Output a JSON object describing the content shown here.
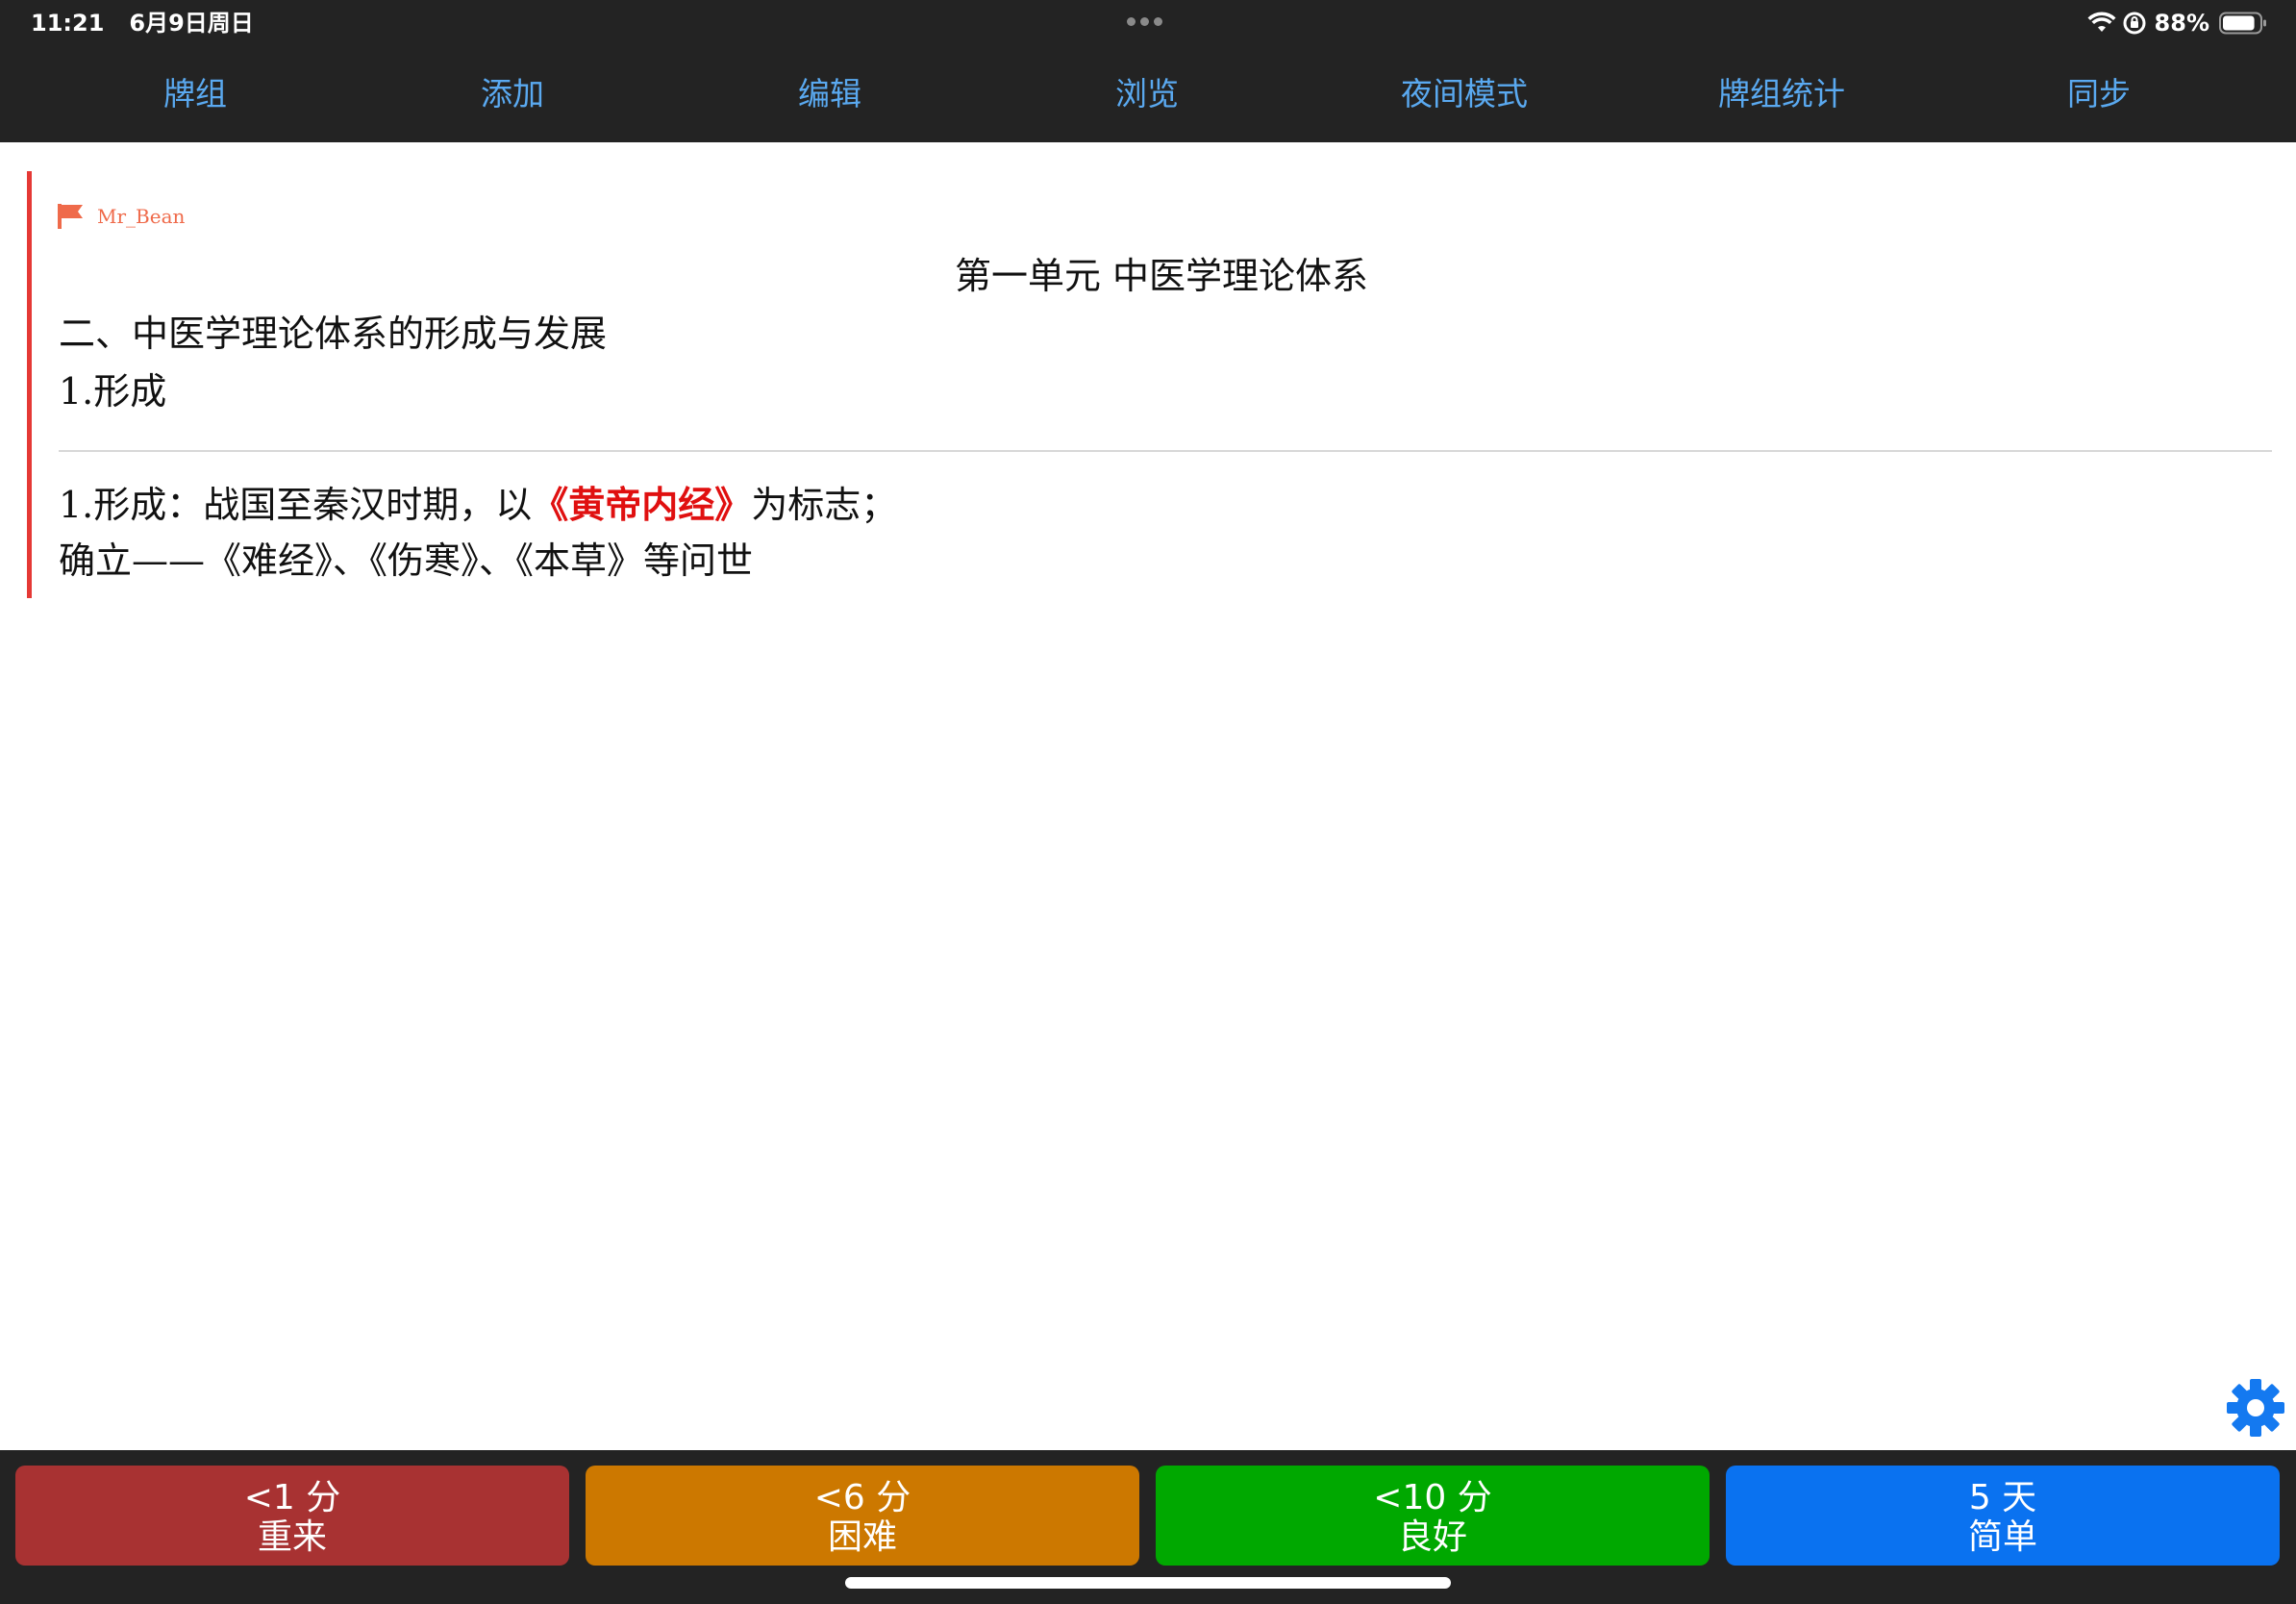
{
  "status_bar": {
    "time": "11:21",
    "date": "6月9日周日",
    "battery_text": "88%",
    "battery_level": 0.88,
    "icons": [
      "wifi-icon",
      "orientation-lock-icon",
      "battery-icon"
    ]
  },
  "nav": {
    "items": [
      {
        "label": "牌组"
      },
      {
        "label": "添加"
      },
      {
        "label": "编辑"
      },
      {
        "label": "浏览"
      },
      {
        "label": "夜间模式"
      },
      {
        "label": "牌组统计"
      },
      {
        "label": "同步"
      }
    ],
    "color": "#5aa9f0"
  },
  "card": {
    "flag_icon": "flag-icon",
    "flag_color": "#ef6a4a",
    "tag": "Mr_Bean",
    "unit_title": "第一单元 中医学理论体系",
    "front": [
      "二、中医学理论体系的形成与发展",
      "1.形成"
    ],
    "back": {
      "line1_prefix": "1.形成：战国至秦汉时期，以",
      "line1_highlight": "《黄帝内经》",
      "line1_suffix": "为标志；",
      "line2": "确立——《难经》、《伤寒》、《本草》等问世",
      "highlight_color": "#e01010"
    },
    "border_color": "#e53935"
  },
  "settings": {
    "icon": "gear-icon",
    "color": "#1479f0"
  },
  "answers": [
    {
      "interval": "<1 分",
      "label": "重来",
      "color": "#a83232"
    },
    {
      "interval": "<6 分",
      "label": "困难",
      "color": "#cc7800"
    },
    {
      "interval": "<10 分",
      "label": "良好",
      "color": "#00a800"
    },
    {
      "interval": "5 天",
      "label": "简单",
      "color": "#0a72f0"
    }
  ]
}
